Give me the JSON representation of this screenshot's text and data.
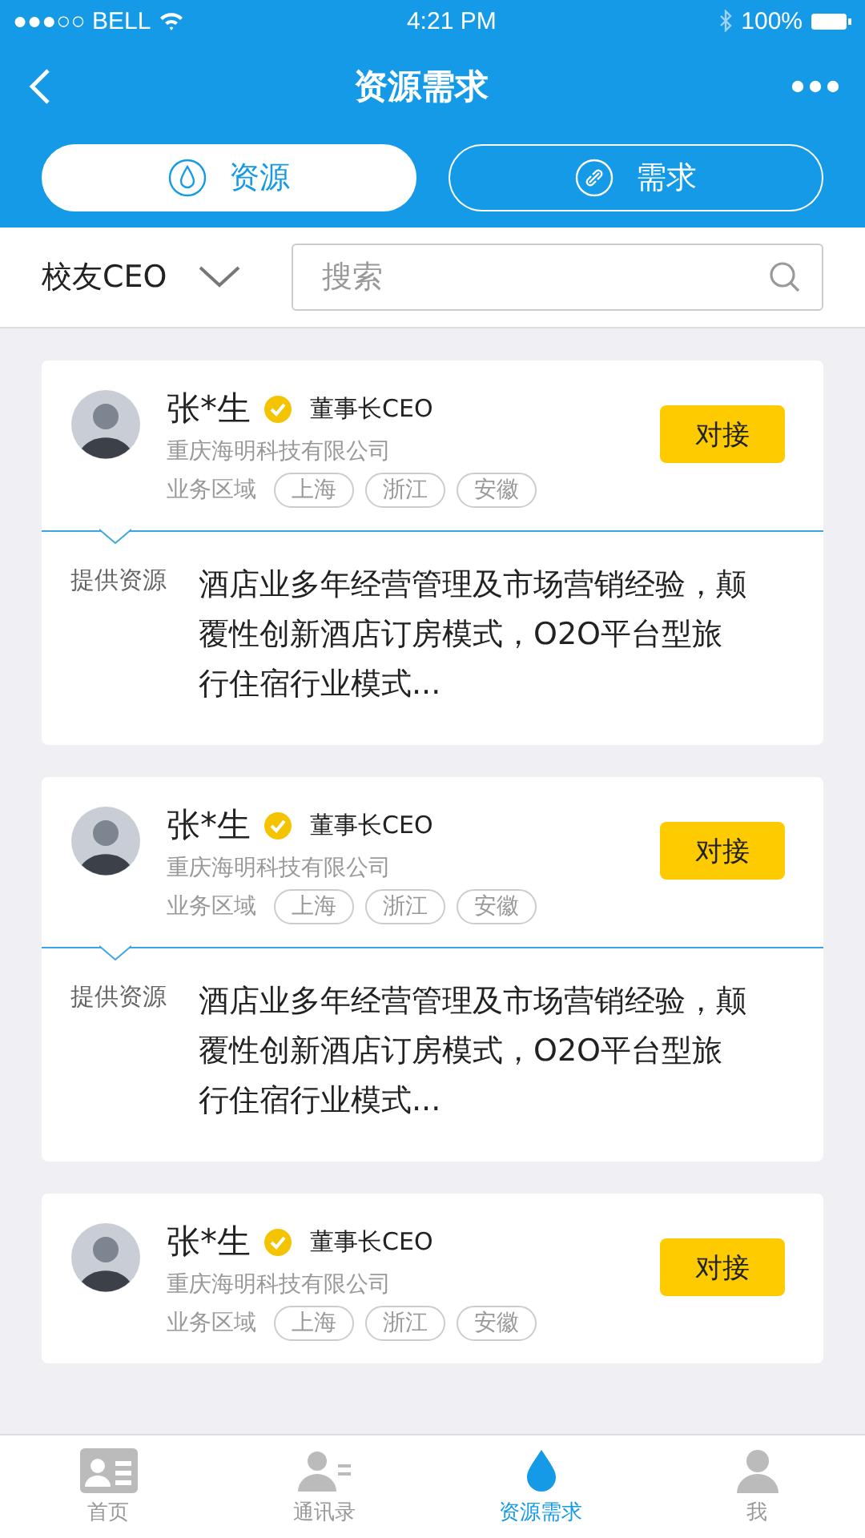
{
  "status_bar": {
    "carrier": "●●●○○ BELL",
    "time": "4:21 PM",
    "battery": "100%"
  },
  "nav": {
    "title": "资源需求"
  },
  "tabs": [
    {
      "label": "资源",
      "kind": "drop",
      "selected": true
    },
    {
      "label": "需求",
      "kind": "link",
      "selected": false
    }
  ],
  "filter": {
    "label": "校友CEO",
    "placeholder": "搜索"
  },
  "cards": [
    {
      "name": "张*生",
      "verified": true,
      "title": "董事长CEO",
      "company": "重庆海明科技有限公司",
      "region_label": "业务区域",
      "regions": [
        "上海",
        "浙江",
        "安徽"
      ],
      "action": "对接",
      "resource_label": "提供资源",
      "resource": "酒店业多年经营管理及市场营销经验，颠覆性创新酒店订房模式，O2O平台型旅行住宿行业模式..."
    },
    {
      "name": "张*生",
      "verified": true,
      "title": "董事长CEO",
      "company": "重庆海明科技有限公司",
      "region_label": "业务区域",
      "regions": [
        "上海",
        "浙江",
        "安徽"
      ],
      "action": "对接",
      "resource_label": "提供资源",
      "resource": "酒店业多年经营管理及市场营销经验，颠覆性创新酒店订房模式，O2O平台型旅行住宿行业模式..."
    },
    {
      "name": "张*生",
      "verified": true,
      "title": "董事长CEO",
      "company": "重庆海明科技有限公司",
      "region_label": "业务区域",
      "regions": [
        "上海",
        "浙江",
        "安徽"
      ],
      "action": "对接"
    }
  ],
  "tab_bar": [
    {
      "label": "首页",
      "kind": "card",
      "selected": false
    },
    {
      "label": "通讯录",
      "kind": "contacts",
      "selected": false
    },
    {
      "label": "资源需求",
      "kind": "drop",
      "selected": true
    },
    {
      "label": "我",
      "kind": "person",
      "selected": false
    }
  ]
}
